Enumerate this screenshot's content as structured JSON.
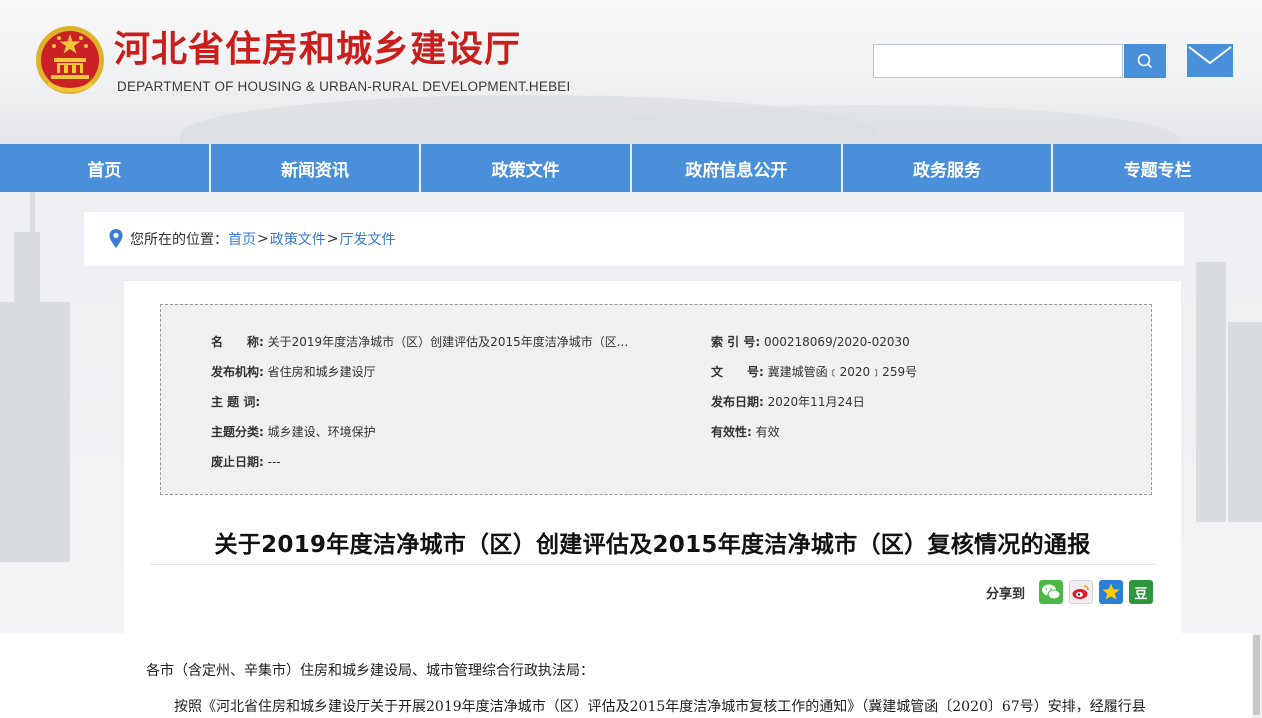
{
  "header": {
    "site_title": "河北省住房和城乡建设厅",
    "site_subtitle": "DEPARTMENT OF HOUSING & URBAN-RURAL DEVELOPMENT.HEBEI",
    "search_placeholder": "",
    "emblem_icon": "national-emblem-icon",
    "search_icon": "search-icon",
    "mail_icon": "mail-icon"
  },
  "nav": [
    "首页",
    "新闻资讯",
    "政策文件",
    "政府信息公开",
    "政务服务",
    "专题专栏"
  ],
  "breadcrumb": {
    "prefix": "您所在的位置：",
    "items": [
      "首页",
      "政策文件",
      "厅发文件"
    ],
    "separator": ">",
    "location_icon": "location-pin-icon"
  },
  "meta": {
    "name_label": "名　　称:",
    "name_value": "关于2019年度洁净城市（区）创建评估及2015年度洁净城市（区...",
    "index_label": "索 引 号:",
    "index_value": "000218069/2020-02030",
    "issuer_label": "发布机构:",
    "issuer_value": "省住房和城乡建设厅",
    "docno_label": "文　　号:",
    "docno_value": "冀建城管函﹝2020﹞259号",
    "subject_label": "主 题 词:",
    "subject_value": "",
    "date_label": "发布日期:",
    "date_value": "2020年11月24日",
    "category_label": "主题分类:",
    "category_value": "城乡建设、环境保护",
    "validity_label": "有效性:",
    "validity_value": "有效",
    "expiry_label": "废止日期:",
    "expiry_value": "---"
  },
  "article": {
    "title": "关于2019年度洁净城市（区）创建评估及2015年度洁净城市（区）复核情况的通报",
    "share_label": "分享到",
    "share_icons": [
      "wechat-icon",
      "weibo-icon",
      "qzone-icon",
      "douban-icon"
    ],
    "douban_glyph": "豆",
    "salutation": "各市（含定州、辛集市）住房和城乡建设局、城市管理综合行政执法局：",
    "paragraph_start": "按照《河北省住房和城乡建设厅关于开展2019年度洁净城市（区）评估及2015年度洁净城市复核工作的通知》（冀建城管函〔2020〕67号）安排，经履行县"
  },
  "colors": {
    "brand_red": "#c81f1c",
    "nav_blue": "#4a8fd9",
    "link_blue": "#3a7bd5"
  }
}
